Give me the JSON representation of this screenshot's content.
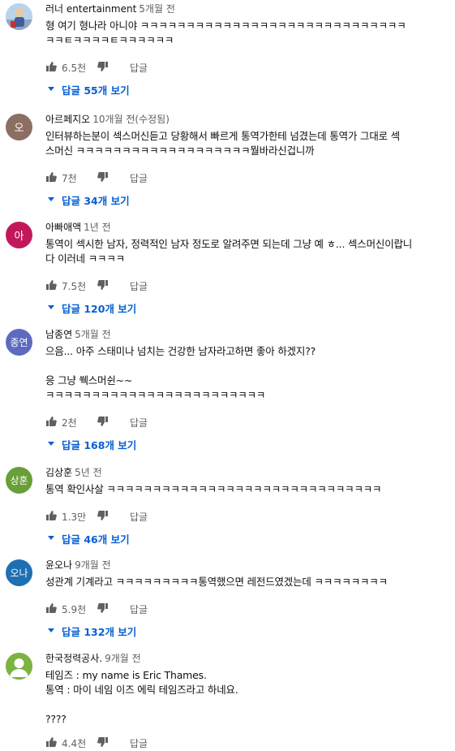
{
  "comments": [
    {
      "author": "러너 entertainment",
      "time": "5개월 전",
      "avatar_text": "",
      "avatar_color": "#9ec3e6",
      "avatar_type": "photo",
      "text": "형 여기 형나라 아니야 ㅋㅋㅋㅋㅋㅋㅋㅋㅋㅋㅋㅋㅋㅋㅋㅋㅋㅋㅋㅋㅋㅋㅋㅋㅋㅋㅋㅋㅋ\nㅋㅋㅌㅋㅋㅋㅋㅌㅋㅋㅋㅋㅋㅋ",
      "likes": "6.5천",
      "reply_label": "답글",
      "replies_label": "답글 55개 보기"
    },
    {
      "author": "아르페지오",
      "time": "10개월 전(수정됨)",
      "avatar_text": "오",
      "avatar_color": "#8d6e63",
      "avatar_type": "letter",
      "text": "인터뷰하는분이 섹스머신듣고 당황해서 빠르게 통역가한테 넘겼는데 통역가 그대로 섹\n스머신 ㅋㅋㅋㅋㅋㅋㅋㅋㅋㅋㅋㅋㅋㅋㅋㅋㅋㅋㅋ뭘바라신겁니까",
      "likes": "7천",
      "reply_label": "답글",
      "replies_label": "답글 34개 보기"
    },
    {
      "author": "아빠애액",
      "time": "1년 전",
      "avatar_text": "아",
      "avatar_color": "#c2185b",
      "avatar_type": "letter",
      "text": "통역이 섹시한 남자, 정력적인 남자 정도로 알려주면 되는데 그냥 예 ㅎ... 섹스머신이랍니\n다 이러네 ㅋㅋㅋㅋ",
      "likes": "7.5천",
      "reply_label": "답글",
      "replies_label": "답글 120개 보기"
    },
    {
      "author": "남종연",
      "time": "5개월 전",
      "avatar_text": "종연",
      "avatar_color": "#5c6bc0",
      "avatar_type": "letter",
      "text": "으음... 아주 스태미나 넘치는 건강한 남자라고하면 좋아 하겠지??\n\n응 그냥 쒝스머쉰~~\nㅋㅋㅋㅋㅋㅋㅋㅋㅋㅋㅋㅋㅋㅋㅋㅋㅋㅋㅋㅋㅋㅋㅋㅋ",
      "likes": "2천",
      "reply_label": "답글",
      "replies_label": "답글 168개 보기"
    },
    {
      "author": "김상훈",
      "time": "5년 전",
      "avatar_text": "상훈",
      "avatar_color": "#689f38",
      "avatar_type": "letter",
      "text": "통역 확인사살 ㅋㅋㅋㅋㅋㅋㅋㅋㅋㅋㅋㅋㅋㅋㅋㅋㅋㅋㅋㅋㅋㅋㅋㅋㅋㅋㅋㅋㅋㅋ",
      "likes": "1.3만",
      "reply_label": "답글",
      "replies_label": "답글 46개 보기"
    },
    {
      "author": "윤오나",
      "time": "9개월 전",
      "avatar_text": "오나",
      "avatar_color": "#1e6fb3",
      "avatar_type": "letter",
      "text": "성관계 기계라고 ㅋㅋㅋㅋㅋㅋㅋㅋㅋ통역했으면 레전드였겠는데 ㅋㅋㅋㅋㅋㅋㅋㅋ",
      "likes": "5.9천",
      "reply_label": "답글",
      "replies_label": "답글 132개 보기"
    },
    {
      "author": "한국정력공사.",
      "time": "9개월 전",
      "avatar_text": "",
      "avatar_color": "#7cb342",
      "avatar_type": "default",
      "text": "테임즈 : my name is Eric Thames.\n통역 : 마이 네임 이즈 에릭 테임즈라고 하네요.\n\n????",
      "likes": "4.4천",
      "reply_label": "답글",
      "replies_label": ""
    }
  ]
}
